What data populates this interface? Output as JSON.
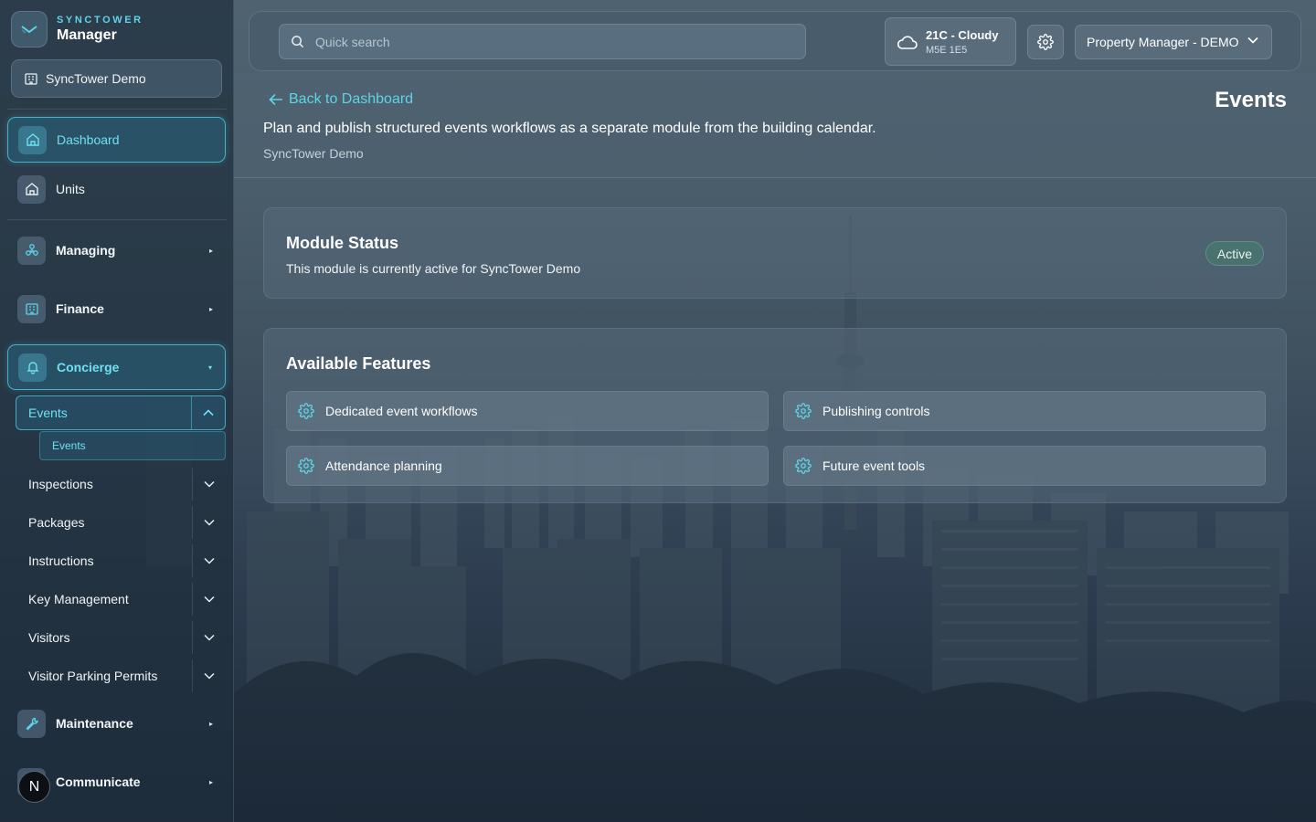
{
  "brand": {
    "top": "SYNCTOWER",
    "bottom": "Manager"
  },
  "org": {
    "name": "SyncTower Demo",
    "icon": "building-icon"
  },
  "sidebar": {
    "items": [
      {
        "label": "Dashboard",
        "icon": "home-icon",
        "active": true
      },
      {
        "label": "Units",
        "icon": "home-icon"
      },
      {
        "label": "Managing",
        "icon": "network-icon",
        "caret": "▸"
      },
      {
        "label": "Finance",
        "icon": "building-icon",
        "caret": "▸"
      },
      {
        "label": "Concierge",
        "icon": "bell-icon",
        "caret": "▾",
        "active": true
      },
      {
        "label": "Maintenance",
        "icon": "wrench-icon",
        "caret": "▸"
      },
      {
        "label": "Communicate",
        "icon": "megaphone-icon",
        "caret": "▸"
      }
    ],
    "concierge": {
      "open_item": "Events",
      "open_sub_item": "Events",
      "sub_items": [
        "Inspections",
        "Packages",
        "Instructions",
        "Key Management",
        "Visitors",
        "Visitor Parking Permits"
      ]
    },
    "avatar_letter": "N"
  },
  "topbar": {
    "search_placeholder": "Quick search",
    "weather_title": "21C - Cloudy",
    "weather_sub": "M5E 1E5",
    "role": "Property Manager - DEMO"
  },
  "page": {
    "back_label": "Back to Dashboard",
    "title": "Events",
    "description": "Plan and publish structured events workflows as a separate module from the building calendar.",
    "org": "SyncTower Demo"
  },
  "module_status": {
    "title": "Module Status",
    "description": "This module is currently active for SyncTower Demo",
    "badge": "Active"
  },
  "features": {
    "title": "Available Features",
    "items": [
      "Dedicated event workflows",
      "Publishing controls",
      "Attendance planning",
      "Future event tools"
    ]
  },
  "colors": {
    "accent": "#5fd3e8",
    "badge": "#4e8c74"
  }
}
